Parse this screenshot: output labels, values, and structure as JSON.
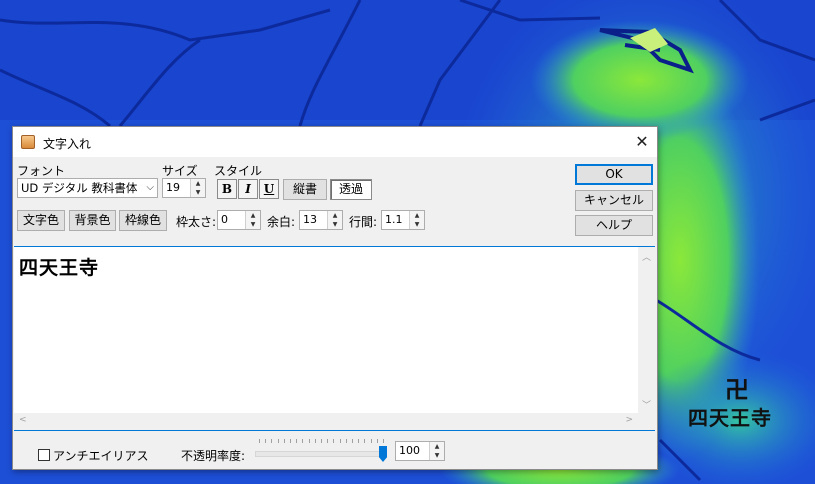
{
  "colors": {
    "accent": "#0078d7",
    "map_blue": "#1e4fd8",
    "map_green": "#6ee04a"
  },
  "map": {
    "temple_symbol": "卍",
    "place_label": "四天王寺"
  },
  "dialog": {
    "title": "文字入れ",
    "close_symbol": "✕",
    "font_label": "フォント",
    "font_value": "UD デジタル 教科書体",
    "size_label": "サイズ",
    "size_value": "19",
    "style_label": "スタイル",
    "bold_label": "B",
    "italic_label": "I",
    "underline_label": "U",
    "vertical_label": "縦書",
    "transparent_label": "透過",
    "text_color_label": "文字色",
    "bg_color_label": "背景色",
    "border_color_label": "枠線色",
    "border_width_label": "枠太さ:",
    "border_width_value": "0",
    "margin_label": "余白:",
    "margin_value": "13",
    "line_spacing_label": "行間:",
    "line_spacing_value": "1.1",
    "ok_label": "OK",
    "cancel_label": "キャンセル",
    "help_label": "ヘルプ",
    "editor_text": "四天王寺",
    "antialias_label": "アンチエイリアス",
    "opacity_label": "不透明率度:",
    "opacity_value": "100",
    "opacity_level": 1.0
  }
}
